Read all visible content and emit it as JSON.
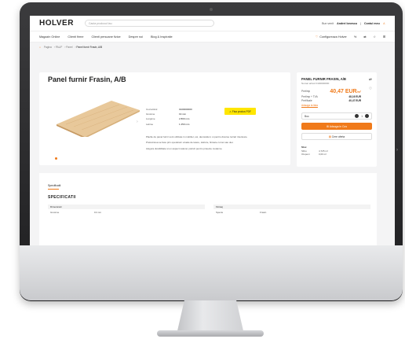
{
  "header": {
    "logo": "HOLVER",
    "search_placeholder": "Cauta produsul tau",
    "greeting": "Bun venit",
    "user": "Andrei Ionescu",
    "account": "Contul meu"
  },
  "nav": {
    "items": [
      "Magazin Online",
      "Clienti firme",
      "Clienti persoane fizice",
      "Despre noi",
      "Blog & Inspiratie"
    ],
    "configurator": "Configureaza Holver"
  },
  "breadcrumb": [
    "Pagina",
    "PAL/F",
    "Panel",
    "Panel furnir Frasin, A/B"
  ],
  "product": {
    "title": "Panel furnir Frasin, A/B",
    "pdf_button": "Fisa produs PDF",
    "specs": [
      {
        "k": "Cod articol",
        "v": "0100000000"
      },
      {
        "k": "Grosime",
        "v": "19 mm"
      },
      {
        "k": "Lungime",
        "v": "2 800 mm"
      },
      {
        "k": "Latime",
        "v": "1 250 mm"
      }
    ],
    "description": [
      "Placile de panel furnir sunt utilizate in mobilier, usi, decoratiuni, si pentru diverse lucrari interioare.",
      "Prelucrarea se face prin operatiuni uzuale de taiere, slefuire, finisare cu lac sau ulei.",
      "Asigura durabilitate si un aspect natural, potrivit pentru proiecte moderne."
    ]
  },
  "side": {
    "title": "PANEL FURNIR FRASIN, A/B",
    "code": "Numar articol 0100000000",
    "price_label": "Pret/mp",
    "price_value": "40,47 EUR",
    "price_unit": "/m²",
    "price_vat_label": "Pret/mp + TVA",
    "price_vat_value": "48,16 EUR",
    "price_sheet_label": "Pret/foaie",
    "price_sheet_value": "40,47 EUR",
    "compare": "Adauga la lista",
    "qty_label": "Buc.",
    "qty_value": "1",
    "add_to_cart": "Adauga in Cos",
    "quote": "Cere oferta",
    "stock_title": "Stoc",
    "stock_rows": [
      {
        "k": "Sibiu",
        "v": "4,725 m²"
      },
      {
        "k": "Otopeni",
        "v": "0,00 m²"
      }
    ]
  },
  "lower": {
    "tab": "Specificatii",
    "section": "SPECIFICATII",
    "table1": {
      "header": "Dimensiuni",
      "cols": [
        "Grosime",
        "19 mm"
      ]
    },
    "table2": {
      "header": "Finisaj",
      "cols": [
        "Specie",
        "Frasin"
      ]
    }
  }
}
